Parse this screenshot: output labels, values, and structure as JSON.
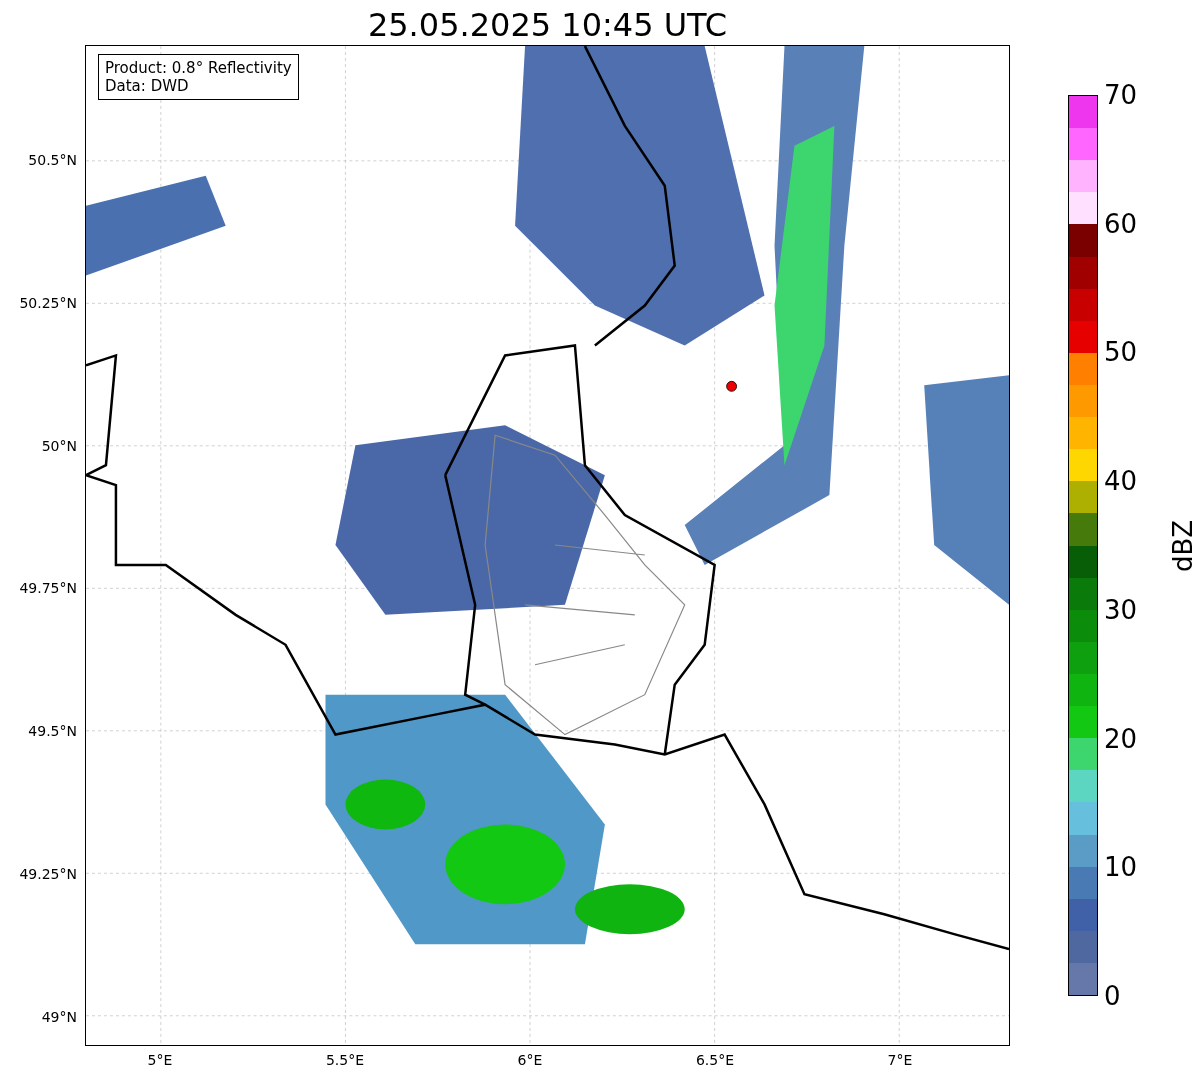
{
  "title": "25.05.2025 10:45 UTC",
  "info_box": {
    "lines": [
      "Product: 0.8° Reflectivity",
      "Data: DWD"
    ]
  },
  "y_ticks": [
    "50.5°N",
    "50.25°N",
    "50°N",
    "49.75°N",
    "49.5°N",
    "49.25°N",
    "49°N"
  ],
  "x_ticks": [
    "5°E",
    "5.5°E",
    "6°E",
    "6.5°E",
    "7°E"
  ],
  "colorbar": {
    "label": "dBZ",
    "segments": [
      {
        "color": "#ee36ee"
      },
      {
        "color": "#ff66ff"
      },
      {
        "color": "#ffb3ff"
      },
      {
        "color": "#ffe0ff"
      },
      {
        "color": "#7a0000"
      },
      {
        "color": "#a00000"
      },
      {
        "color": "#c80000"
      },
      {
        "color": "#e60000"
      },
      {
        "color": "#ff7f00"
      },
      {
        "color": "#ff9900"
      },
      {
        "color": "#ffb400"
      },
      {
        "color": "#ffd700"
      },
      {
        "color": "#adb000"
      },
      {
        "color": "#467a0a"
      },
      {
        "color": "#075e07"
      },
      {
        "color": "#0a7a0a"
      },
      {
        "color": "#0b8c0b"
      },
      {
        "color": "#0ea00e"
      },
      {
        "color": "#10b410"
      },
      {
        "color": "#12c812"
      },
      {
        "color": "#3dd66e"
      },
      {
        "color": "#5cd6c0"
      },
      {
        "color": "#66c0dd"
      },
      {
        "color": "#5a9cc6"
      },
      {
        "color": "#4a7ab4"
      },
      {
        "color": "#4060a8"
      },
      {
        "color": "#5068a0"
      },
      {
        "color": "#6677aa"
      }
    ],
    "ticks": [
      "70",
      "60",
      "50",
      "40",
      "30",
      "20",
      "10",
      "0"
    ]
  }
}
